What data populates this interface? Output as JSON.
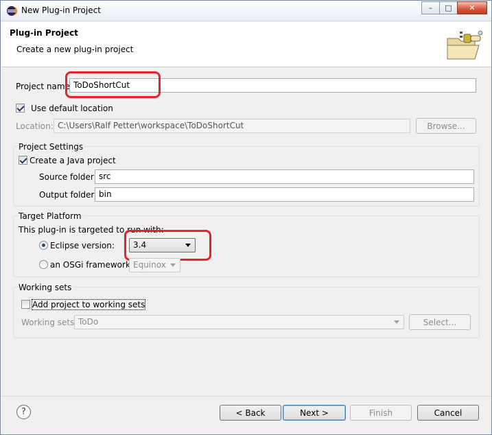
{
  "window": {
    "title": "New Plug-in Project",
    "minimize": "–",
    "maximize": "□",
    "close": "✕"
  },
  "header": {
    "title": "Plug-in Project",
    "subtitle": "Create a new plug-in project"
  },
  "project": {
    "name_label": "Project name:",
    "name_value": "ToDoShortCut",
    "use_default_label": "Use default location",
    "use_default_checked": true,
    "location_label": "Location:",
    "location_value": "C:\\Users\\Ralf Petter\\workspace\\ToDoShortCut",
    "browse_label": "Browse..."
  },
  "project_settings": {
    "title": "Project Settings",
    "create_java_label": "Create a Java project",
    "create_java_checked": true,
    "source_label": "Source folder:",
    "source_value": "src",
    "output_label": "Output folder:",
    "output_value": "bin"
  },
  "target_platform": {
    "title": "Target Platform",
    "desc": "This plug-in is targeted to run with:",
    "eclipse_label": "Eclipse version:",
    "eclipse_selected": "3.4",
    "osgi_label": "an OSGi framework:",
    "osgi_selected": "Equinox"
  },
  "working_sets": {
    "title": "Working sets",
    "add_label": "Add project to working sets",
    "add_checked": false,
    "sets_label": "Working sets:",
    "sets_value": "ToDo",
    "select_label": "Select..."
  },
  "footer": {
    "help_icon": "?",
    "back_label": "< Back",
    "next_label": "Next >",
    "finish_label": "Finish",
    "cancel_label": "Cancel"
  },
  "colors": {
    "highlight": "#e8222a",
    "window_bg": "#f0f0f0"
  }
}
